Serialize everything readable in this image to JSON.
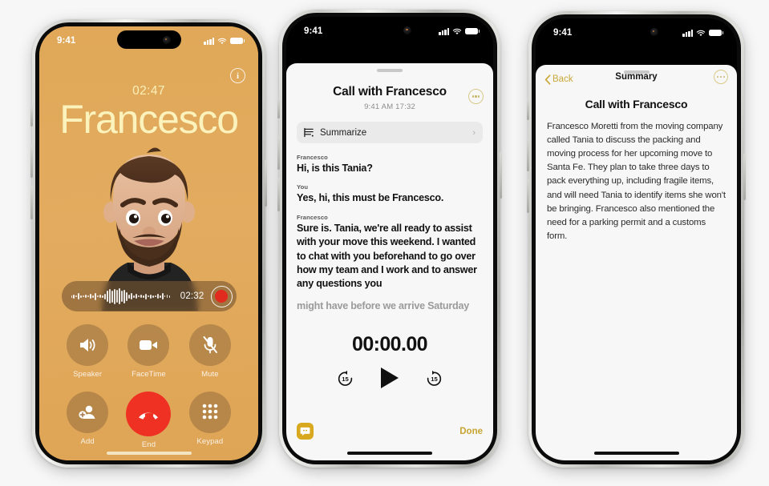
{
  "scene": {
    "background_color": "#f7f7f7",
    "accent_gold": "#c9a93a",
    "call_bg": "#e0a858",
    "name_color": "#fbf2bc",
    "end_red": "#ef3124"
  },
  "phone1": {
    "name": "in-call-screen",
    "status_bar": {
      "time": "9:41",
      "signal_icon": "cellular-bars-icon",
      "wifi_icon": "wifi-icon",
      "battery_icon": "battery-icon"
    },
    "info_button": {
      "label": "i",
      "icon": "info-circle-icon"
    },
    "call_timer": "02:47",
    "caller_name": "Francesco",
    "avatar": "memoji-avatar",
    "recording": {
      "waveform_icon": "audio-waveform-icon",
      "elapsed": "02:32",
      "record_button": "record-stop-button"
    },
    "controls": [
      {
        "label": "Speaker",
        "icon": "speaker-icon"
      },
      {
        "label": "FaceTime",
        "icon": "video-camera-icon"
      },
      {
        "label": "Mute",
        "icon": "microphone-muted-icon"
      },
      {
        "label": "Add",
        "icon": "add-person-icon"
      },
      {
        "label": "End",
        "icon": "end-call-icon"
      },
      {
        "label": "Keypad",
        "icon": "keypad-grid-icon"
      }
    ]
  },
  "phone2": {
    "name": "call-transcript-screen",
    "status_bar": {
      "time": "9:41",
      "signal_icon": "cellular-bars-icon",
      "wifi_icon": "wifi-icon",
      "battery_icon": "battery-icon"
    },
    "title": "Call with Francesco",
    "subtitle": "9:41 AM  17:32",
    "more_button": "ellipsis-circle-icon",
    "summarize": {
      "label": "Summarize",
      "icon": "text-lines-icon",
      "chevron": "chevron-right-icon"
    },
    "transcript": [
      {
        "speaker": "Francesco",
        "text": "Hi, is this Tania?",
        "faded": false
      },
      {
        "speaker": "You",
        "text": "Yes, hi, this must be Francesco.",
        "faded": false
      },
      {
        "speaker": "Francesco",
        "text": "Sure is. Tania, we're all ready to assist with your move this weekend. I wanted to chat with you beforehand to go over how my team and I work and to answer any questions you",
        "faded": false
      },
      {
        "speaker": "",
        "text": "might have before we arrive Saturday",
        "faded": true
      }
    ],
    "player": {
      "timecode": "00:00.00",
      "rewind_icon": "rewind-15-icon",
      "rewind_label": "15",
      "play_icon": "play-icon",
      "forward_icon": "forward-15-icon",
      "forward_label": "15"
    },
    "footer": {
      "quote_icon": "quote-bubble-icon",
      "done_label": "Done"
    }
  },
  "phone3": {
    "name": "call-summary-screen",
    "status_bar": {
      "time": "9:41",
      "signal_icon": "cellular-bars-icon",
      "wifi_icon": "wifi-icon",
      "battery_icon": "battery-icon"
    },
    "nav": {
      "back_label": "Back",
      "back_icon": "chevron-left-icon",
      "title": "Summary",
      "more_button": "ellipsis-circle-icon"
    },
    "heading": "Call with Francesco",
    "body": "Francesco Moretti from the moving company called Tania to discuss the packing and moving process for her upcoming move to Santa Fe. They plan to take three days to pack everything up, including fragile items, and will need Tania to identify items she won't be bringing. Francesco also mentioned the need for a parking permit and a customs form."
  }
}
